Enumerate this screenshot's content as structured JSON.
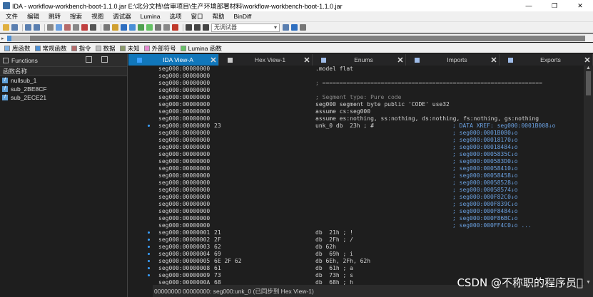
{
  "window": {
    "title": "IDA - workflow-workbench-boot-1.1.0.jar E:\\北分文档\\信审项目\\生产环境部署材料\\workflow-workbench-boot-1.1.0.jar",
    "minimize": "—",
    "maximize": "❐",
    "close": "✕"
  },
  "menu": [
    "文件",
    "编辑",
    "跳转",
    "搜索",
    "视图",
    "调试器",
    "Lumina",
    "选项",
    "窗口",
    "帮助",
    "BinDiff"
  ],
  "toolbar": {
    "debugger_select": "无调试器",
    "colors": {
      "accent": "#2f6fc0",
      "run": "#444444",
      "stop": "#c0392b"
    }
  },
  "legend": [
    {
      "label": "库函数",
      "color": "#7fb2e6"
    },
    {
      "label": "常规函数",
      "color": "#4a8fd6"
    },
    {
      "label": "指令",
      "color": "#b56b6b"
    },
    {
      "label": "数据",
      "color": "#bdbdbd"
    },
    {
      "label": "未知",
      "color": "#8a9a6a"
    },
    {
      "label": "外部符号",
      "color": "#e58ad1"
    },
    {
      "label": "Lumina 函数",
      "color": "#66c266"
    }
  ],
  "functions_panel": {
    "title": "Functions",
    "column_header": "函数名称",
    "items": [
      "nullsub_1",
      "sub_2BE8CF",
      "sub_2ECE21"
    ]
  },
  "tabs": [
    {
      "label": "IDA View-A",
      "active": true,
      "icon_color": "#3aa0ff"
    },
    {
      "label": "Hex View-1",
      "active": false,
      "icon_color": "#cccccc"
    },
    {
      "label": "Enums",
      "active": false,
      "icon_color": "#9fbce8"
    },
    {
      "label": "Imports",
      "active": false,
      "icon_color": "#9fbce8"
    },
    {
      "label": "Exports",
      "active": false,
      "icon_color": "#9fbce8"
    }
  ],
  "tab_close": "✕",
  "disasm": {
    "seg_addr": "seg000:00000000",
    "lines": [
      {
        "addr": "seg000:00000000",
        "hex": "",
        "code": ".model flat",
        "xref": ""
      },
      {
        "addr": "seg000:00000000",
        "hex": "",
        "code": "",
        "xref": ""
      },
      {
        "addr": "seg000:00000000",
        "hex": "",
        "cmt": "; ================================================================",
        "xref": ""
      },
      {
        "addr": "seg000:00000000",
        "hex": "",
        "code": "",
        "xref": ""
      },
      {
        "addr": "seg000:00000000",
        "hex": "",
        "cmt": "; Segment type: Pure code",
        "xref": ""
      },
      {
        "addr": "seg000:00000000",
        "hex": "",
        "code": "seg000 segment byte public 'CODE' use32",
        "xref": ""
      },
      {
        "addr": "seg000:00000000",
        "hex": "",
        "code": "assume cs:seg000",
        "xref": ""
      },
      {
        "addr": "seg000:00000000",
        "hex": "",
        "code": "assume es:nothing, ss:nothing, ds:nothing, fs:nothing, gs:nothing",
        "xref": ""
      },
      {
        "addr": "seg000:00000000",
        "hex": "23",
        "code": "unk_0 db  23h ; #",
        "xref": "; DATA XREF: seg000:0001B008↓o"
      },
      {
        "addr": "seg000:00000000",
        "hex": "",
        "code": "",
        "xref": "; seg000:0001B080↓o"
      },
      {
        "addr": "seg000:00000000",
        "hex": "",
        "code": "",
        "xref": "; seg000:00018170↓o"
      },
      {
        "addr": "seg000:00000000",
        "hex": "",
        "code": "",
        "xref": "; seg000:00018484↓o"
      },
      {
        "addr": "seg000:00000000",
        "hex": "",
        "code": "",
        "xref": "; seg000:0005835C↓o"
      },
      {
        "addr": "seg000:00000000",
        "hex": "",
        "code": "",
        "xref": "; seg000:000583D0↓o"
      },
      {
        "addr": "seg000:00000000",
        "hex": "",
        "code": "",
        "xref": "; seg000:00058410↓o"
      },
      {
        "addr": "seg000:00000000",
        "hex": "",
        "code": "",
        "xref": "; seg000:00058458↓o"
      },
      {
        "addr": "seg000:00000000",
        "hex": "",
        "code": "",
        "xref": "; seg000:00058528↓o"
      },
      {
        "addr": "seg000:00000000",
        "hex": "",
        "code": "",
        "xref": "; seg000:00058574↓o"
      },
      {
        "addr": "seg000:00000000",
        "hex": "",
        "code": "",
        "xref": "; seg000:000F82C0↓o"
      },
      {
        "addr": "seg000:00000000",
        "hex": "",
        "code": "",
        "xref": "; seg000:000F839C↓o"
      },
      {
        "addr": "seg000:00000000",
        "hex": "",
        "code": "",
        "xref": "; seg000:000F8484↓o"
      },
      {
        "addr": "seg000:00000000",
        "hex": "",
        "code": "",
        "xref": "; seg000:000F86BC↓o"
      },
      {
        "addr": "seg000:00000000",
        "hex": "",
        "code": "",
        "xref": "; seg000:000FF4C0↓o ..."
      },
      {
        "addr": "seg000:00000001",
        "hex": "21",
        "code": "db  21h ; !",
        "xref": ""
      },
      {
        "addr": "seg000:00000002",
        "hex": "2F",
        "code": "db  2Fh ; /",
        "xref": ""
      },
      {
        "addr": "seg000:00000003",
        "hex": "62",
        "code": "db 62h",
        "xref": ""
      },
      {
        "addr": "seg000:00000004",
        "hex": "69",
        "code": "db  69h ; i",
        "xref": ""
      },
      {
        "addr": "seg000:00000005",
        "hex": "6E 2F 62",
        "code": "db 6Eh, 2Fh, 62h",
        "xref": ""
      },
      {
        "addr": "seg000:00000008",
        "hex": "61",
        "code": "db  61h ; a",
        "xref": ""
      },
      {
        "addr": "seg000:00000009",
        "hex": "73",
        "code": "db  73h ; s",
        "xref": ""
      },
      {
        "addr": "seg000:0000000A",
        "hex": "68",
        "code": "db  68h ; h",
        "xref": ""
      }
    ]
  },
  "status": "00000000 00000000: seg000:unk_0 (已同步到 Hex View-1)",
  "watermark": "CSDN @不称职的程序员\u0000"
}
